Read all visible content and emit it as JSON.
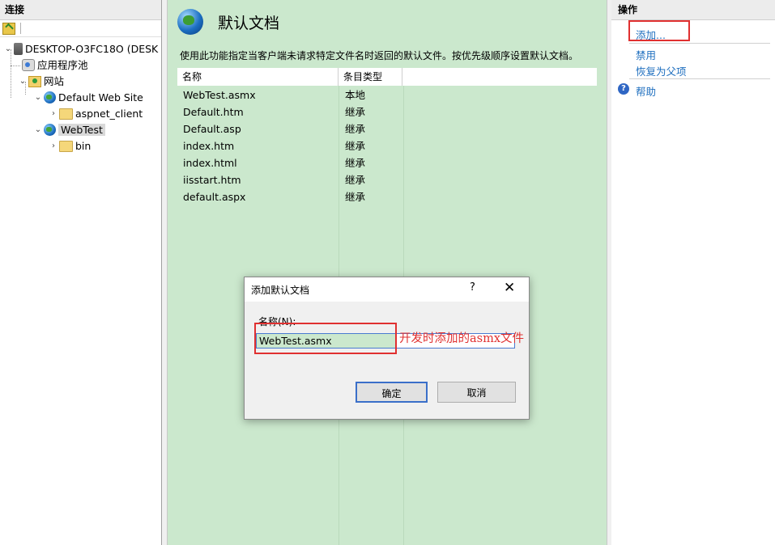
{
  "connections": {
    "header": "连接",
    "tree": [
      {
        "label": "DESKTOP-O3FC18O (DESK",
        "icon": "server-icon"
      },
      {
        "label": "应用程序池",
        "icon": "app-pool-icon"
      },
      {
        "label": "网站",
        "icon": "sites-folder-icon"
      },
      {
        "label": "Default Web Site",
        "icon": "globe-icon"
      },
      {
        "label": "aspnet_client",
        "icon": "folder-icon"
      },
      {
        "label": "WebTest",
        "icon": "globe-icon",
        "selected": true
      },
      {
        "label": "bin",
        "icon": "folder-icon"
      }
    ]
  },
  "feature": {
    "title": "默认文档",
    "description": "使用此功能指定当客户端未请求特定文件名时返回的默认文件。按优先级顺序设置默认文档。",
    "columns": [
      "名称",
      "条目类型"
    ],
    "rows": [
      {
        "name": "WebTest.asmx",
        "type": "本地"
      },
      {
        "name": "Default.htm",
        "type": "继承"
      },
      {
        "name": "Default.asp",
        "type": "继承"
      },
      {
        "name": "index.htm",
        "type": "继承"
      },
      {
        "name": "index.html",
        "type": "继承"
      },
      {
        "name": "iisstart.htm",
        "type": "继承"
      },
      {
        "name": "default.aspx",
        "type": "继承"
      }
    ]
  },
  "actions": {
    "header": "操作",
    "add": "添加...",
    "disable": "禁用",
    "revert": "恢复为父项",
    "help": "帮助"
  },
  "dialog": {
    "title": "添加默认文档",
    "help_glyph": "?",
    "close_glyph": "✕",
    "name_label": "名称(N):",
    "name_value": "WebTest.asmx",
    "ok_label": "确定",
    "cancel_label": "取消"
  },
  "annotation": "开发时添加的asmx文件",
  "colors": {
    "feature_bg": "#cbe8cd",
    "link": "#1f6fbf",
    "highlight_red": "#e03030"
  }
}
